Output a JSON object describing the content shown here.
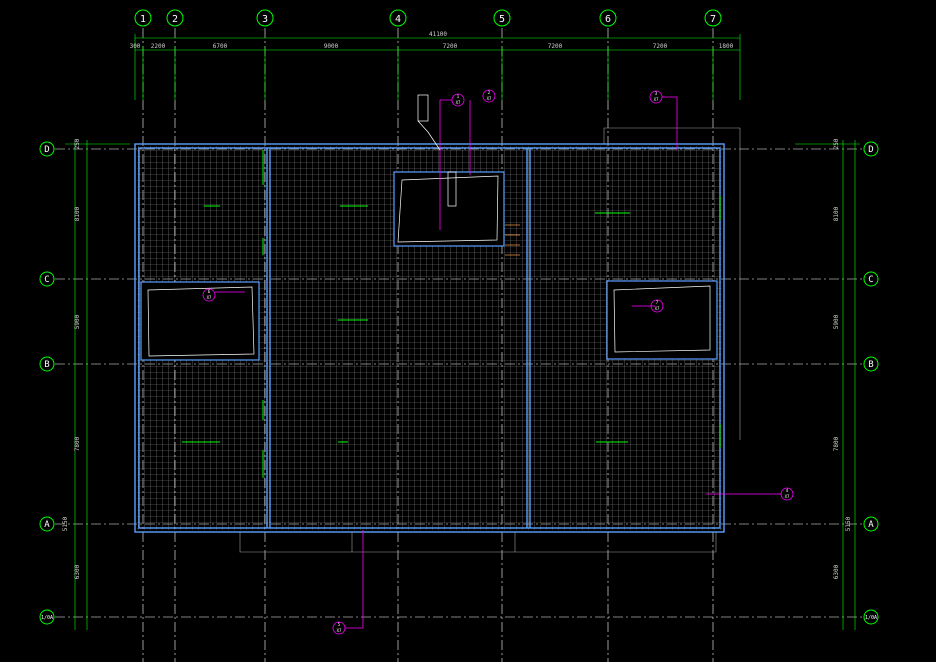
{
  "drawing": {
    "grid_columns": [
      "1",
      "2",
      "3",
      "4",
      "5",
      "6",
      "7"
    ],
    "grid_rows": [
      "D",
      "C",
      "B",
      "A",
      "1/0A"
    ],
    "left_row_labels": [
      "D",
      "C",
      "B",
      "A",
      "1/0A"
    ],
    "top_overall_dim": "41100",
    "top_dims": [
      "300",
      "2200",
      "6700",
      "9000",
      "7200",
      "7200",
      "7200",
      "1800"
    ],
    "left_dims": [
      "250",
      "8100",
      "5900",
      "7800",
      "5150",
      "6300"
    ],
    "right_dims": [
      "250",
      "8100",
      "5900",
      "7800",
      "5150",
      "6300"
    ],
    "colors": {
      "grid_line": "#ffffff",
      "axis_bubble": "#00ff00",
      "dimension": "#00ff00",
      "roof_outline": "#5aa0ff",
      "hatch": "#9a9a9a",
      "leader": "#ff00ff",
      "note_text": "#00ff00"
    },
    "detail_tags": [
      {
        "top": "1",
        "bottom": "X7"
      },
      {
        "top": "2",
        "bottom": "X7"
      },
      {
        "top": "3",
        "bottom": "X7"
      },
      {
        "top": "4",
        "bottom": "X7"
      },
      {
        "top": "5",
        "bottom": "X7"
      },
      {
        "top": "6",
        "bottom": "X7"
      },
      {
        "top": "7",
        "bottom": "X7"
      }
    ]
  }
}
